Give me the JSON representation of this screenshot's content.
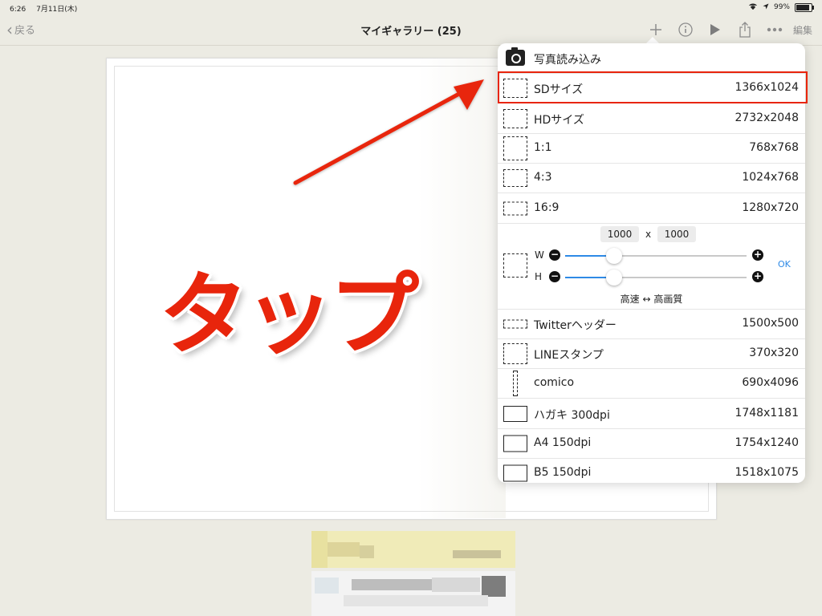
{
  "status": {
    "time": "6:26",
    "date": "7月11日(木)",
    "battery": "99%",
    "battery_level": 0.99
  },
  "nav": {
    "back": "戻る",
    "title": "マイギャラリー (25)",
    "edit": "編集"
  },
  "annotation": {
    "text": "タップ"
  },
  "menu": {
    "photo_import": "写真読み込み",
    "items_top": [
      {
        "label": "SDサイズ",
        "value": "1366x1024"
      },
      {
        "label": "HDサイズ",
        "value": "2732x2048"
      },
      {
        "label": "1:1",
        "value": "768x768"
      },
      {
        "label": "4:3",
        "value": "1024x768"
      },
      {
        "label": "16:9",
        "value": "1280x720"
      }
    ],
    "custom": {
      "width": "1000",
      "height": "1000",
      "times": "x",
      "w_label": "W",
      "h_label": "H",
      "w_level": 0.27,
      "h_level": 0.27,
      "minus": "−",
      "plus": "+",
      "ok": "OK",
      "quality": "高速 ↔ 高画質"
    },
    "items_bottom": [
      {
        "label": "Twitterヘッダー",
        "value": "1500x500"
      },
      {
        "label": "LINEスタンプ",
        "value": "370x320"
      },
      {
        "label": "comico",
        "value": "690x4096"
      },
      {
        "label": "ハガキ 300dpi",
        "value": "1748x1181"
      },
      {
        "label": "A4 150dpi",
        "value": "1754x1240"
      },
      {
        "label": "B5 150dpi",
        "value": "1518x1075"
      }
    ]
  },
  "colors": {
    "accent": "#2e8ae6",
    "annotation": "#e8250c",
    "background": "#ecebe3"
  }
}
